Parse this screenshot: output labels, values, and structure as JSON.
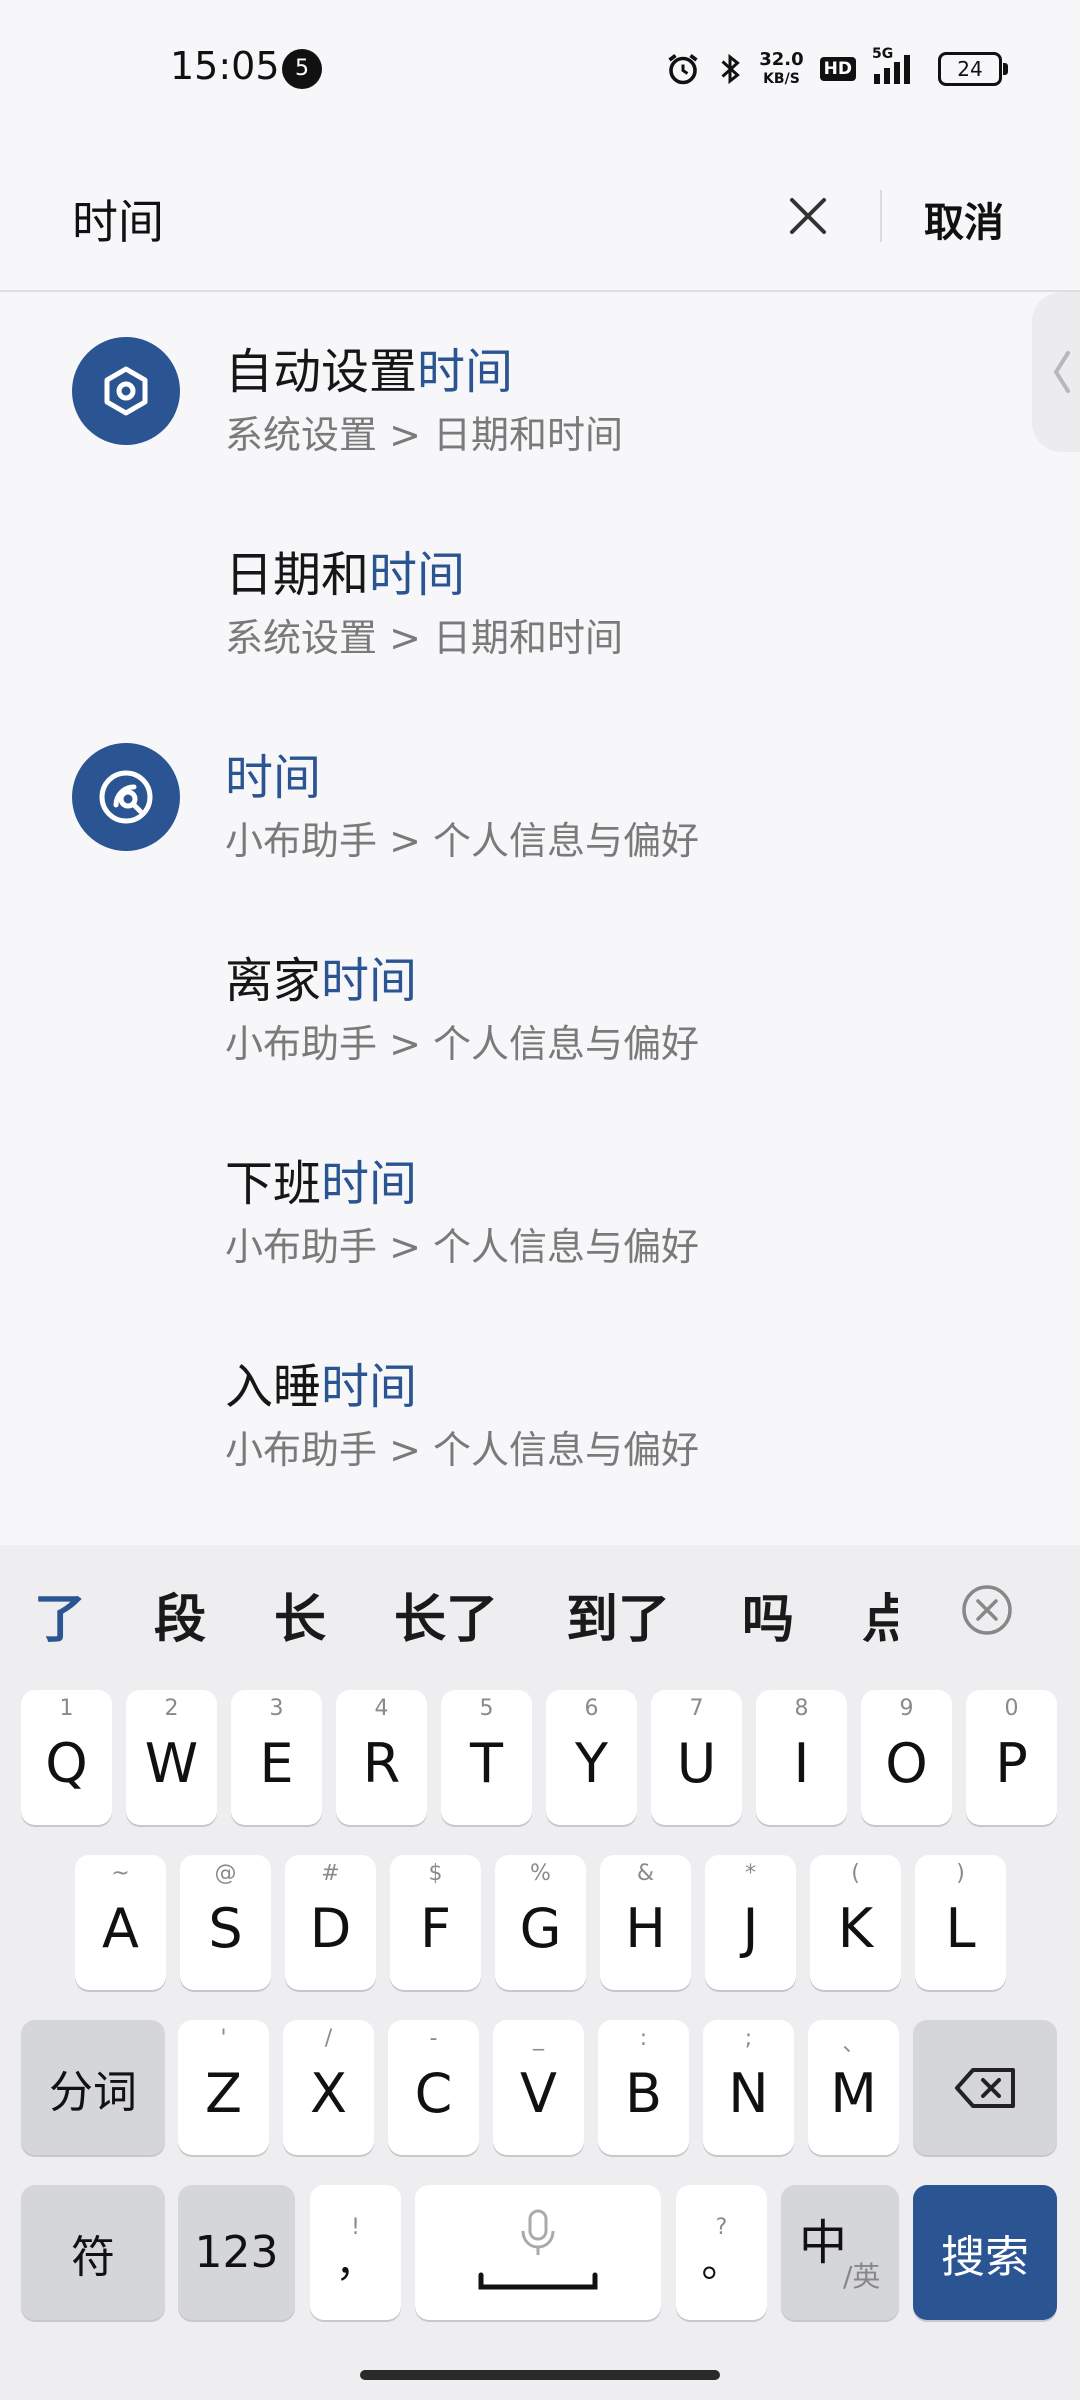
{
  "status_bar": {
    "time": "15:05",
    "notification_count": "5",
    "net_speed_value": "32.0",
    "net_speed_unit": "KB/S",
    "hd_label": "HD",
    "network_label": "5G",
    "battery_level": "24"
  },
  "search": {
    "query": "时间",
    "cancel_label": "取消"
  },
  "results": [
    {
      "prefix": "自动设置",
      "highlight": "时间",
      "suffix": "",
      "path": "系统设置 > 日期和时间",
      "icon": "settings-hexagon-icon"
    },
    {
      "prefix": "日期和",
      "highlight": "时间",
      "suffix": "",
      "path": "系统设置 > 日期和时间",
      "icon": ""
    },
    {
      "prefix": "",
      "highlight": "时间",
      "suffix": "",
      "path": "小布助手 > 个人信息与偏好",
      "icon": "breeno-assistant-icon"
    },
    {
      "prefix": "离家",
      "highlight": "时间",
      "suffix": "",
      "path": "小布助手 > 个人信息与偏好",
      "icon": ""
    },
    {
      "prefix": "下班",
      "highlight": "时间",
      "suffix": "",
      "path": "小布助手 > 个人信息与偏好",
      "icon": ""
    },
    {
      "prefix": "入睡",
      "highlight": "时间",
      "suffix": "",
      "path": "小布助手 > 个人信息与偏好",
      "icon": ""
    }
  ],
  "keyboard": {
    "candidates": [
      "了",
      "段",
      "长",
      "长了",
      "到了",
      "吗",
      "点"
    ],
    "row1": [
      {
        "main": "Q",
        "sub": "1"
      },
      {
        "main": "W",
        "sub": "2"
      },
      {
        "main": "E",
        "sub": "3"
      },
      {
        "main": "R",
        "sub": "4"
      },
      {
        "main": "T",
        "sub": "5"
      },
      {
        "main": "Y",
        "sub": "6"
      },
      {
        "main": "U",
        "sub": "7"
      },
      {
        "main": "I",
        "sub": "8"
      },
      {
        "main": "O",
        "sub": "9"
      },
      {
        "main": "P",
        "sub": "0"
      }
    ],
    "row2": [
      {
        "main": "A",
        "sub": "~"
      },
      {
        "main": "S",
        "sub": "@"
      },
      {
        "main": "D",
        "sub": "#"
      },
      {
        "main": "F",
        "sub": "$"
      },
      {
        "main": "G",
        "sub": "%"
      },
      {
        "main": "H",
        "sub": "&"
      },
      {
        "main": "J",
        "sub": "*"
      },
      {
        "main": "K",
        "sub": "("
      },
      {
        "main": "L",
        "sub": ")"
      }
    ],
    "row3": [
      {
        "main": "Z",
        "sub": "'"
      },
      {
        "main": "X",
        "sub": "/"
      },
      {
        "main": "C",
        "sub": "-"
      },
      {
        "main": "V",
        "sub": "_"
      },
      {
        "main": "B",
        "sub": ":"
      },
      {
        "main": "N",
        "sub": ";"
      },
      {
        "main": "M",
        "sub": "、"
      }
    ],
    "segment_label": "分词",
    "symbol_label": "符",
    "numeric_label": "123",
    "comma_main": "，",
    "comma_sub": "!",
    "period_main": "。",
    "period_sub": "?",
    "lang_main": "中",
    "lang_sub": "/英",
    "search_label": "搜索"
  },
  "colors": {
    "accent": "#2a5492",
    "background": "#f7f7f9",
    "keyboard_bg": "#eeeef1"
  }
}
